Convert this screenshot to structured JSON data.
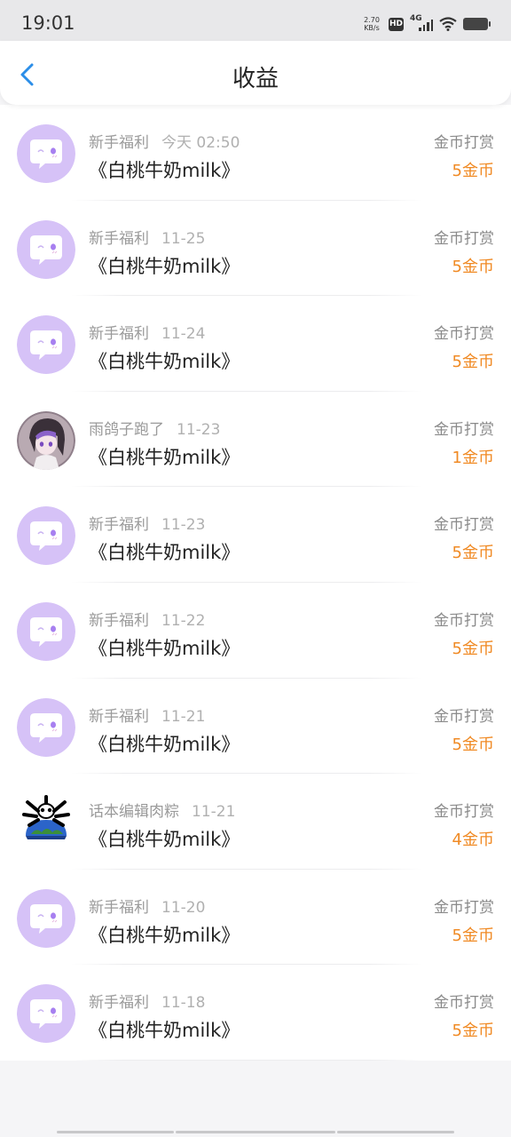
{
  "status_bar": {
    "time": "19:01",
    "net_speed_value": "2.70",
    "net_speed_unit": "KB/s",
    "hd": "HD",
    "network": "4G"
  },
  "header": {
    "title": "收益",
    "back_icon": "chevron-left-icon"
  },
  "colors": {
    "accent_blue": "#2c8ee8",
    "amount_orange": "#f08a24",
    "avatar_purple": "#d6c2f7"
  },
  "items": [
    {
      "avatar": "chat-bubble-avatar",
      "name": "新手福利",
      "date": "今天 02:50",
      "title": "《白桃牛奶milk》",
      "type": "金币打赏",
      "amount": "5金币"
    },
    {
      "avatar": "chat-bubble-avatar",
      "name": "新手福利",
      "date": "11-25",
      "title": "《白桃牛奶milk》",
      "type": "金币打赏",
      "amount": "5金币"
    },
    {
      "avatar": "chat-bubble-avatar",
      "name": "新手福利",
      "date": "11-24",
      "title": "《白桃牛奶milk》",
      "type": "金币打赏",
      "amount": "5金币"
    },
    {
      "avatar": "anime-girl-avatar",
      "name": "雨鸽子跑了",
      "date": "11-23",
      "title": "《白桃牛奶milk》",
      "type": "金币打赏",
      "amount": "1金币"
    },
    {
      "avatar": "chat-bubble-avatar",
      "name": "新手福利",
      "date": "11-23",
      "title": "《白桃牛奶milk》",
      "type": "金币打赏",
      "amount": "5金币"
    },
    {
      "avatar": "chat-bubble-avatar",
      "name": "新手福利",
      "date": "11-22",
      "title": "《白桃牛奶milk》",
      "type": "金币打赏",
      "amount": "5金币"
    },
    {
      "avatar": "chat-bubble-avatar",
      "name": "新手福利",
      "date": "11-21",
      "title": "《白桃牛奶milk》",
      "type": "金币打赏",
      "amount": "5金币"
    },
    {
      "avatar": "skull-earth-avatar",
      "name": "话本编辑肉粽",
      "date": "11-21",
      "title": "《白桃牛奶milk》",
      "type": "金币打赏",
      "amount": "4金币"
    },
    {
      "avatar": "chat-bubble-avatar",
      "name": "新手福利",
      "date": "11-20",
      "title": "《白桃牛奶milk》",
      "type": "金币打赏",
      "amount": "5金币"
    },
    {
      "avatar": "chat-bubble-avatar",
      "name": "新手福利",
      "date": "11-18",
      "title": "《白桃牛奶milk》",
      "type": "金币打赏",
      "amount": "5金币"
    }
  ]
}
